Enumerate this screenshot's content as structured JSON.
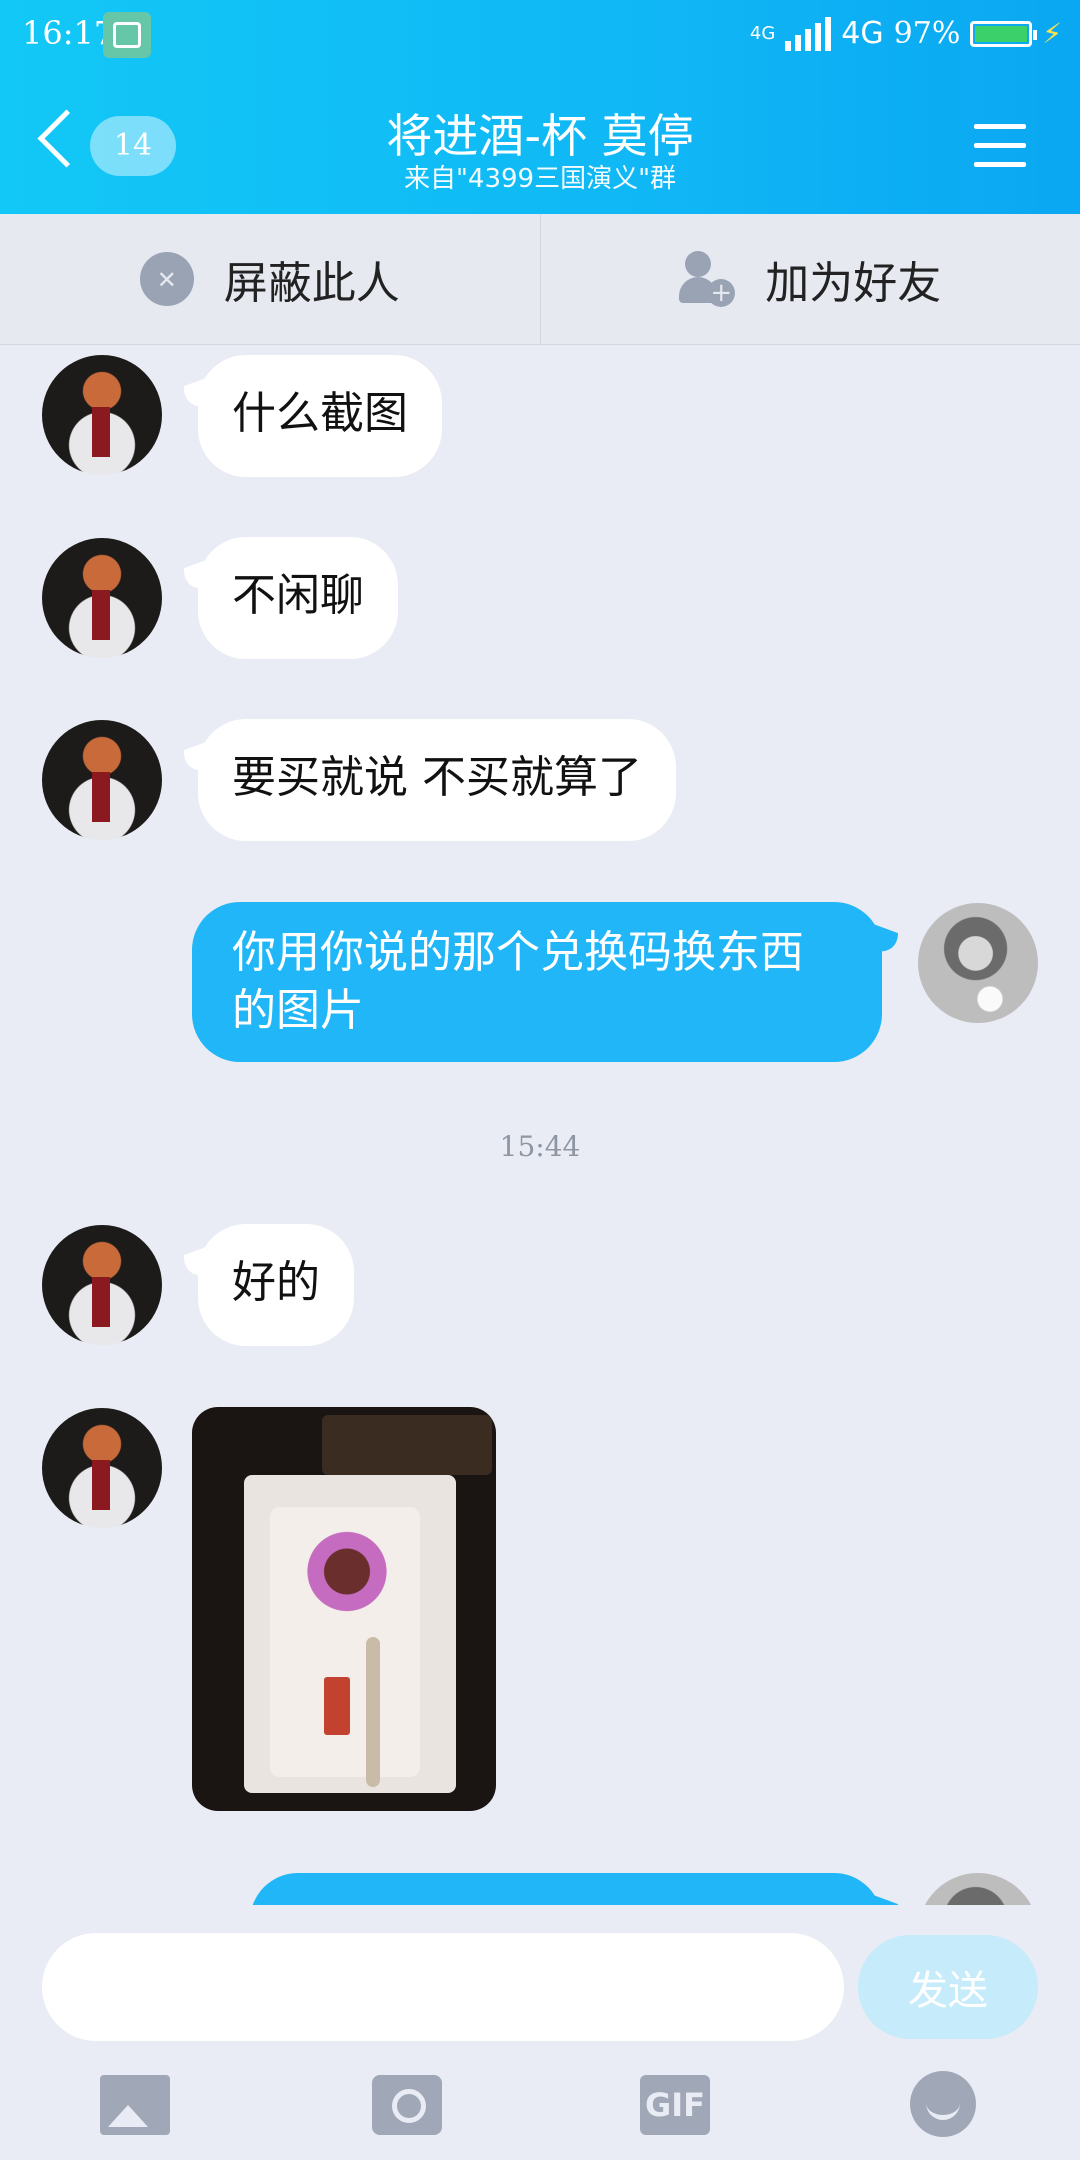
{
  "status_bar": {
    "time": "16:17",
    "network_small": "4G",
    "network": "4G",
    "battery": "97%"
  },
  "header": {
    "unread_count": "14",
    "title": "将进酒-杯 莫停",
    "subtitle": "来自\"4399三国演义\"群"
  },
  "actions": {
    "block_label": "屏蔽此人",
    "add_friend_label": "加为好友"
  },
  "messages": [
    {
      "from": "other",
      "text": "什么截图"
    },
    {
      "from": "other",
      "text": "不闲聊"
    },
    {
      "from": "other",
      "text": "要买就说 不买就算了"
    },
    {
      "from": "me",
      "text": "你用你说的那个兑换码换东西的图片"
    },
    {
      "from": "other",
      "text": "好的"
    }
  ],
  "timestamp": "15:44",
  "composer": {
    "input_value": "",
    "send_label": "发送"
  },
  "toolbar": {
    "gif_label": "GIF"
  },
  "colors": {
    "header": "#10b7f5",
    "out_bubble": "#20b6f7",
    "background": "#e9ecf4"
  },
  "icons": [
    "screenshot-icon",
    "signal-icon",
    "battery-icon",
    "back-icon",
    "menu-icon",
    "block-icon",
    "add-friend-icon",
    "image-icon",
    "camera-icon",
    "gif-icon",
    "emoji-icon"
  ]
}
